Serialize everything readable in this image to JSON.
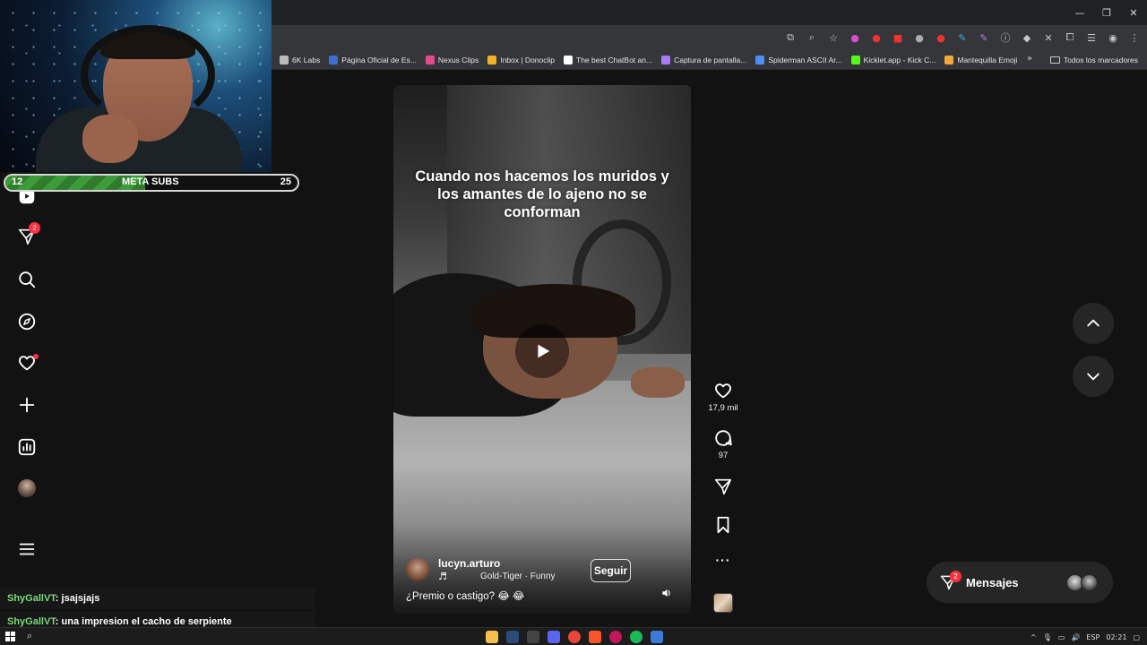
{
  "window": {
    "minimize": "—",
    "restore": "❐",
    "close": "✕"
  },
  "toolbar_icons": [
    "screen-cast-icon",
    "zoom-icon",
    "bookmark-star-icon",
    "extension-icons"
  ],
  "bookmarks": {
    "items": [
      {
        "label": "6K Labs",
        "color": "#bbbbbb"
      },
      {
        "label": "Página Oficial de Es...",
        "color": "#3b6fd1"
      },
      {
        "label": "Nexus Clips",
        "color": "#e14b8a"
      },
      {
        "label": "Inbox | Donoclip",
        "color": "#f0b429"
      },
      {
        "label": "The best ChatBot an...",
        "color": "#ffffff"
      },
      {
        "label": "Captura de pantalla...",
        "color": "#a97bf2"
      },
      {
        "label": "Spiderman ASCII Ar...",
        "color": "#4e8ef7"
      },
      {
        "label": "Kicklet.app - Kick C...",
        "color": "#53fc18"
      },
      {
        "label": "Mantequilla Emoji",
        "color": "#f2a73b"
      }
    ],
    "more": "»",
    "all_label": "Todos los marcadores"
  },
  "sidebar": {
    "notifications_badge": "2"
  },
  "reel": {
    "caption_overlay": "Cuando nos hacemos los muridos y los amantes de lo ajeno no se conforman",
    "author": "lucyn.arturo",
    "music_note": "♬",
    "music": "Gold-Tiger · Funny",
    "follow_label": "Seguir",
    "post_caption": "¿Premio o castigo? 😂 😂"
  },
  "actions": {
    "likes": "17,9 mil",
    "comments": "97",
    "more": "···"
  },
  "messages": {
    "label": "Mensajes",
    "badge": "2"
  },
  "stream_overlay": {
    "goal_start": "12",
    "goal_label": "META SUBS",
    "goal_end": "25",
    "goal_progress": 0.48
  },
  "chat": [
    {
      "user": "ShyGallVT",
      "message": "jsajsjajs"
    },
    {
      "user": "ShyGallVT",
      "message": "una impresion el cacho de serpiente"
    }
  ],
  "taskbar": {
    "lang": "ESP",
    "time": "02:21"
  },
  "colors": {
    "badge": "#ff3040",
    "goal_green": "#3e9b3a",
    "chat_user": "#7cd97c"
  }
}
